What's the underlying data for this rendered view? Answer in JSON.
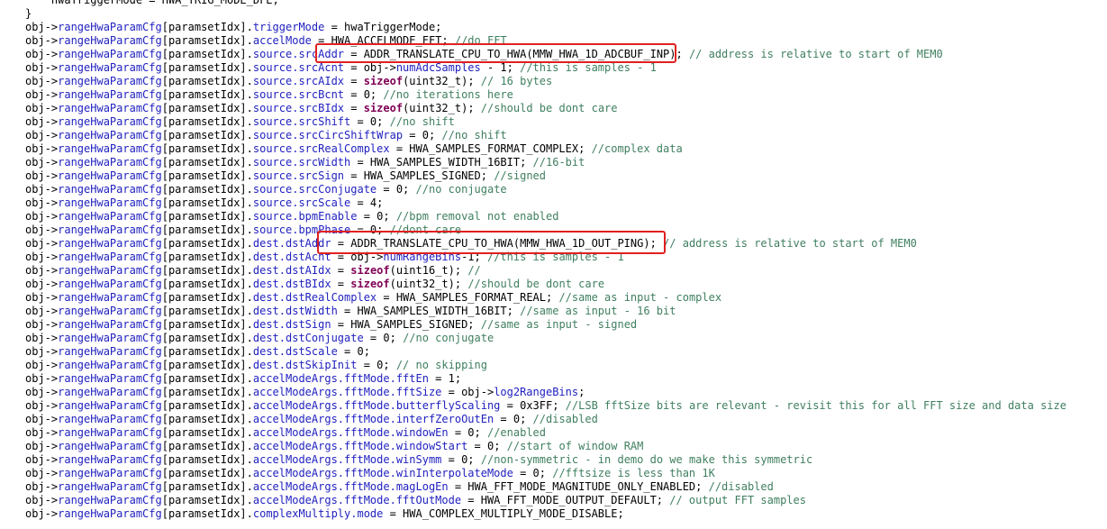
{
  "editor": {
    "lines": [
      [
        {
          "t": "    hwaTriggerMode = HWA_TRIG_MODE_DFE;",
          "c": "plain"
        }
      ],
      [
        {
          "t": "}",
          "c": "plain"
        }
      ],
      [
        {
          "t": "obj->",
          "c": "plain"
        },
        {
          "t": "rangeHwaParamCfg",
          "c": "blue"
        },
        {
          "t": "[paramsetIdx].",
          "c": "plain"
        },
        {
          "t": "triggerMode",
          "c": "blue"
        },
        {
          "t": " = hwaTriggerMode;",
          "c": "plain"
        }
      ],
      [
        {
          "t": "obj->",
          "c": "plain"
        },
        {
          "t": "rangeHwaParamCfg",
          "c": "blue"
        },
        {
          "t": "[paramsetIdx].",
          "c": "plain"
        },
        {
          "t": "accelMode",
          "c": "blue"
        },
        {
          "t": " = HWA_ACCELMODE_FFT; ",
          "c": "plain"
        },
        {
          "t": "//do FFT",
          "c": "cm"
        }
      ],
      [
        {
          "t": "obj->",
          "c": "plain"
        },
        {
          "t": "rangeHwaParamCfg",
          "c": "blue"
        },
        {
          "t": "[paramsetIdx].",
          "c": "plain"
        },
        {
          "t": "source.srcAddr",
          "c": "blue"
        },
        {
          "t": " = ADDR_TRANSLATE_CPU_TO_HWA(MMW_HWA_1D_ADCBUF_INP); ",
          "c": "plain"
        },
        {
          "t": "// address is relative to start of MEM0",
          "c": "cm"
        }
      ],
      [
        {
          "t": "obj->",
          "c": "plain"
        },
        {
          "t": "rangeHwaParamCfg",
          "c": "blue"
        },
        {
          "t": "[paramsetIdx].",
          "c": "plain"
        },
        {
          "t": "source.srcAcnt",
          "c": "blue"
        },
        {
          "t": " = obj->",
          "c": "plain"
        },
        {
          "t": "numAdcSamples",
          "c": "blue"
        },
        {
          "t": " - 1; ",
          "c": "plain"
        },
        {
          "t": "//this is samples - 1",
          "c": "cm"
        }
      ],
      [
        {
          "t": "obj->",
          "c": "plain"
        },
        {
          "t": "rangeHwaParamCfg",
          "c": "blue"
        },
        {
          "t": "[paramsetIdx].",
          "c": "plain"
        },
        {
          "t": "source.srcAIdx",
          "c": "blue"
        },
        {
          "t": " = ",
          "c": "plain"
        },
        {
          "t": "sizeof",
          "c": "kw"
        },
        {
          "t": "(uint32_t); ",
          "c": "plain"
        },
        {
          "t": "// 16 bytes",
          "c": "cm"
        }
      ],
      [
        {
          "t": "obj->",
          "c": "plain"
        },
        {
          "t": "rangeHwaParamCfg",
          "c": "blue"
        },
        {
          "t": "[paramsetIdx].",
          "c": "plain"
        },
        {
          "t": "source.srcBcnt",
          "c": "blue"
        },
        {
          "t": " = 0; ",
          "c": "plain"
        },
        {
          "t": "//no iterations here",
          "c": "cm"
        }
      ],
      [
        {
          "t": "obj->",
          "c": "plain"
        },
        {
          "t": "rangeHwaParamCfg",
          "c": "blue"
        },
        {
          "t": "[paramsetIdx].",
          "c": "plain"
        },
        {
          "t": "source.srcBIdx",
          "c": "blue"
        },
        {
          "t": " = ",
          "c": "plain"
        },
        {
          "t": "sizeof",
          "c": "kw"
        },
        {
          "t": "(uint32_t); ",
          "c": "plain"
        },
        {
          "t": "//should be dont care",
          "c": "cm"
        }
      ],
      [
        {
          "t": "obj->",
          "c": "plain"
        },
        {
          "t": "rangeHwaParamCfg",
          "c": "blue"
        },
        {
          "t": "[paramsetIdx].",
          "c": "plain"
        },
        {
          "t": "source.srcShift",
          "c": "blue"
        },
        {
          "t": " = 0; ",
          "c": "plain"
        },
        {
          "t": "//no shift",
          "c": "cm"
        }
      ],
      [
        {
          "t": "obj->",
          "c": "plain"
        },
        {
          "t": "rangeHwaParamCfg",
          "c": "blue"
        },
        {
          "t": "[paramsetIdx].",
          "c": "plain"
        },
        {
          "t": "source.srcCircShiftWrap",
          "c": "blue"
        },
        {
          "t": " = 0; ",
          "c": "plain"
        },
        {
          "t": "//no shift",
          "c": "cm"
        }
      ],
      [
        {
          "t": "obj->",
          "c": "plain"
        },
        {
          "t": "rangeHwaParamCfg",
          "c": "blue"
        },
        {
          "t": "[paramsetIdx].",
          "c": "plain"
        },
        {
          "t": "source.srcRealComplex",
          "c": "blue"
        },
        {
          "t": " = HWA_SAMPLES_FORMAT_COMPLEX; ",
          "c": "plain"
        },
        {
          "t": "//complex data",
          "c": "cm"
        }
      ],
      [
        {
          "t": "obj->",
          "c": "plain"
        },
        {
          "t": "rangeHwaParamCfg",
          "c": "blue"
        },
        {
          "t": "[paramsetIdx].",
          "c": "plain"
        },
        {
          "t": "source.srcWidth",
          "c": "blue"
        },
        {
          "t": " = HWA_SAMPLES_WIDTH_16BIT; ",
          "c": "plain"
        },
        {
          "t": "//16-bit",
          "c": "cm"
        }
      ],
      [
        {
          "t": "obj->",
          "c": "plain"
        },
        {
          "t": "rangeHwaParamCfg",
          "c": "blue"
        },
        {
          "t": "[paramsetIdx].",
          "c": "plain"
        },
        {
          "t": "source.srcSign",
          "c": "blue"
        },
        {
          "t": " = HWA_SAMPLES_SIGNED; ",
          "c": "plain"
        },
        {
          "t": "//signed",
          "c": "cm"
        }
      ],
      [
        {
          "t": "obj->",
          "c": "plain"
        },
        {
          "t": "rangeHwaParamCfg",
          "c": "blue"
        },
        {
          "t": "[paramsetIdx].",
          "c": "plain"
        },
        {
          "t": "source.srcConjugate",
          "c": "blue"
        },
        {
          "t": " = 0; ",
          "c": "plain"
        },
        {
          "t": "//no conjugate",
          "c": "cm"
        }
      ],
      [
        {
          "t": "obj->",
          "c": "plain"
        },
        {
          "t": "rangeHwaParamCfg",
          "c": "blue"
        },
        {
          "t": "[paramsetIdx].",
          "c": "plain"
        },
        {
          "t": "source.srcScale",
          "c": "blue"
        },
        {
          "t": " = 4;",
          "c": "plain"
        }
      ],
      [
        {
          "t": "obj->",
          "c": "plain"
        },
        {
          "t": "rangeHwaParamCfg",
          "c": "blue"
        },
        {
          "t": "[paramsetIdx].",
          "c": "plain"
        },
        {
          "t": "source.bpmEnable",
          "c": "blue"
        },
        {
          "t": " = 0; ",
          "c": "plain"
        },
        {
          "t": "//bpm removal not enabled",
          "c": "cm"
        }
      ],
      [
        {
          "t": "obj->",
          "c": "plain"
        },
        {
          "t": "rangeHwaParamCfg",
          "c": "blue"
        },
        {
          "t": "[paramsetIdx].",
          "c": "plain"
        },
        {
          "t": "source.bpmPhase",
          "c": "blue"
        },
        {
          "t": " = 0; ",
          "c": "plain"
        },
        {
          "t": "//dont care",
          "c": "cm"
        }
      ],
      [
        {
          "t": "obj->",
          "c": "plain"
        },
        {
          "t": "rangeHwaParamCfg",
          "c": "blue"
        },
        {
          "t": "[paramsetIdx].",
          "c": "plain"
        },
        {
          "t": "dest.dstAddr",
          "c": "blue"
        },
        {
          "t": " = ADDR_TRANSLATE_CPU_TO_HWA(MMW_HWA_1D_OUT_PING); ",
          "c": "plain"
        },
        {
          "t": "// address is relative to start of MEM0",
          "c": "cm"
        }
      ],
      [
        {
          "t": "obj->",
          "c": "plain"
        },
        {
          "t": "rangeHwaParamCfg",
          "c": "blue"
        },
        {
          "t": "[paramsetIdx].",
          "c": "plain"
        },
        {
          "t": "dest.dstAcnt",
          "c": "blue"
        },
        {
          "t": " = obj->",
          "c": "plain"
        },
        {
          "t": "numRangeBins",
          "c": "blue"
        },
        {
          "t": "-1; ",
          "c": "plain"
        },
        {
          "t": "//this is samples - 1",
          "c": "cm"
        }
      ],
      [
        {
          "t": "obj->",
          "c": "plain"
        },
        {
          "t": "rangeHwaParamCfg",
          "c": "blue"
        },
        {
          "t": "[paramsetIdx].",
          "c": "plain"
        },
        {
          "t": "dest.dstAIdx",
          "c": "blue"
        },
        {
          "t": " = ",
          "c": "plain"
        },
        {
          "t": "sizeof",
          "c": "kw"
        },
        {
          "t": "(uint16_t); ",
          "c": "plain"
        },
        {
          "t": "//",
          "c": "cm"
        }
      ],
      [
        {
          "t": "obj->",
          "c": "plain"
        },
        {
          "t": "rangeHwaParamCfg",
          "c": "blue"
        },
        {
          "t": "[paramsetIdx].",
          "c": "plain"
        },
        {
          "t": "dest.dstBIdx",
          "c": "blue"
        },
        {
          "t": " = ",
          "c": "plain"
        },
        {
          "t": "sizeof",
          "c": "kw"
        },
        {
          "t": "(uint32_t); ",
          "c": "plain"
        },
        {
          "t": "//should be dont care",
          "c": "cm"
        }
      ],
      [
        {
          "t": "obj->",
          "c": "plain"
        },
        {
          "t": "rangeHwaParamCfg",
          "c": "blue"
        },
        {
          "t": "[paramsetIdx].",
          "c": "plain"
        },
        {
          "t": "dest.dstRealComplex",
          "c": "blue"
        },
        {
          "t": " = HWA_SAMPLES_FORMAT_REAL; ",
          "c": "plain"
        },
        {
          "t": "//same as input - complex",
          "c": "cm"
        }
      ],
      [
        {
          "t": "obj->",
          "c": "plain"
        },
        {
          "t": "rangeHwaParamCfg",
          "c": "blue"
        },
        {
          "t": "[paramsetIdx].",
          "c": "plain"
        },
        {
          "t": "dest.dstWidth",
          "c": "blue"
        },
        {
          "t": " = HWA_SAMPLES_WIDTH_16BIT; ",
          "c": "plain"
        },
        {
          "t": "//same as input - 16 bit",
          "c": "cm"
        }
      ],
      [
        {
          "t": "obj->",
          "c": "plain"
        },
        {
          "t": "rangeHwaParamCfg",
          "c": "blue"
        },
        {
          "t": "[paramsetIdx].",
          "c": "plain"
        },
        {
          "t": "dest.dstSign",
          "c": "blue"
        },
        {
          "t": " = HWA_SAMPLES_SIGNED; ",
          "c": "plain"
        },
        {
          "t": "//same as input - signed",
          "c": "cm"
        }
      ],
      [
        {
          "t": "obj->",
          "c": "plain"
        },
        {
          "t": "rangeHwaParamCfg",
          "c": "blue"
        },
        {
          "t": "[paramsetIdx].",
          "c": "plain"
        },
        {
          "t": "dest.dstConjugate",
          "c": "blue"
        },
        {
          "t": " = 0; ",
          "c": "plain"
        },
        {
          "t": "//no conjugate",
          "c": "cm"
        }
      ],
      [
        {
          "t": "obj->",
          "c": "plain"
        },
        {
          "t": "rangeHwaParamCfg",
          "c": "blue"
        },
        {
          "t": "[paramsetIdx].",
          "c": "plain"
        },
        {
          "t": "dest.dstScale",
          "c": "blue"
        },
        {
          "t": " = 0;",
          "c": "plain"
        }
      ],
      [
        {
          "t": "obj->",
          "c": "plain"
        },
        {
          "t": "rangeHwaParamCfg",
          "c": "blue"
        },
        {
          "t": "[paramsetIdx].",
          "c": "plain"
        },
        {
          "t": "dest.dstSkipInit",
          "c": "blue"
        },
        {
          "t": " = 0; ",
          "c": "plain"
        },
        {
          "t": "// no skipping",
          "c": "cm"
        }
      ],
      [
        {
          "t": "obj->",
          "c": "plain"
        },
        {
          "t": "rangeHwaParamCfg",
          "c": "blue"
        },
        {
          "t": "[paramsetIdx].",
          "c": "plain"
        },
        {
          "t": "accelModeArgs.fftMode.fftEn",
          "c": "blue"
        },
        {
          "t": " = 1;",
          "c": "plain"
        }
      ],
      [
        {
          "t": "obj->",
          "c": "plain"
        },
        {
          "t": "rangeHwaParamCfg",
          "c": "blue"
        },
        {
          "t": "[paramsetIdx].",
          "c": "plain"
        },
        {
          "t": "accelModeArgs.fftMode.fftSize",
          "c": "blue"
        },
        {
          "t": " = obj->",
          "c": "plain"
        },
        {
          "t": "log2RangeBins",
          "c": "blue"
        },
        {
          "t": ";",
          "c": "plain"
        }
      ],
      [
        {
          "t": "obj->",
          "c": "plain"
        },
        {
          "t": "rangeHwaParamCfg",
          "c": "blue"
        },
        {
          "t": "[paramsetIdx].",
          "c": "plain"
        },
        {
          "t": "accelModeArgs.fftMode.butterflyScaling",
          "c": "blue"
        },
        {
          "t": " = 0x3FF; ",
          "c": "plain"
        },
        {
          "t": "//LSB fftSize bits are relevant - revisit this for all FFT size and data size",
          "c": "cm"
        }
      ],
      [
        {
          "t": "obj->",
          "c": "plain"
        },
        {
          "t": "rangeHwaParamCfg",
          "c": "blue"
        },
        {
          "t": "[paramsetIdx].",
          "c": "plain"
        },
        {
          "t": "accelModeArgs.fftMode.interfZeroOutEn",
          "c": "blue"
        },
        {
          "t": " = 0; ",
          "c": "plain"
        },
        {
          "t": "//disabled",
          "c": "cm"
        }
      ],
      [
        {
          "t": "obj->",
          "c": "plain"
        },
        {
          "t": "rangeHwaParamCfg",
          "c": "blue"
        },
        {
          "t": "[paramsetIdx].",
          "c": "plain"
        },
        {
          "t": "accelModeArgs.fftMode.windowEn",
          "c": "blue"
        },
        {
          "t": " = 0; ",
          "c": "plain"
        },
        {
          "t": "//enabled",
          "c": "cm"
        }
      ],
      [
        {
          "t": "obj->",
          "c": "plain"
        },
        {
          "t": "rangeHwaParamCfg",
          "c": "blue"
        },
        {
          "t": "[paramsetIdx].",
          "c": "plain"
        },
        {
          "t": "accelModeArgs.fftMode.windowStart",
          "c": "blue"
        },
        {
          "t": " = 0; ",
          "c": "plain"
        },
        {
          "t": "//start of window RAM",
          "c": "cm"
        }
      ],
      [
        {
          "t": "obj->",
          "c": "plain"
        },
        {
          "t": "rangeHwaParamCfg",
          "c": "blue"
        },
        {
          "t": "[paramsetIdx].",
          "c": "plain"
        },
        {
          "t": "accelModeArgs.fftMode.winSymm",
          "c": "blue"
        },
        {
          "t": " = 0; ",
          "c": "plain"
        },
        {
          "t": "//non-symmetric - in demo do we make this symmetric",
          "c": "cm"
        }
      ],
      [
        {
          "t": "obj->",
          "c": "plain"
        },
        {
          "t": "rangeHwaParamCfg",
          "c": "blue"
        },
        {
          "t": "[paramsetIdx].",
          "c": "plain"
        },
        {
          "t": "accelModeArgs.fftMode.winInterpolateMode",
          "c": "blue"
        },
        {
          "t": " = 0; ",
          "c": "plain"
        },
        {
          "t": "//fftsize is less than 1K",
          "c": "cm"
        }
      ],
      [
        {
          "t": "obj->",
          "c": "plain"
        },
        {
          "t": "rangeHwaParamCfg",
          "c": "blue"
        },
        {
          "t": "[paramsetIdx].",
          "c": "plain"
        },
        {
          "t": "accelModeArgs.fftMode.magLogEn",
          "c": "blue"
        },
        {
          "t": " = HWA_FFT_MODE_MAGNITUDE_ONLY_ENABLED; ",
          "c": "plain"
        },
        {
          "t": "//disabled",
          "c": "cm"
        }
      ],
      [
        {
          "t": "obj->",
          "c": "plain"
        },
        {
          "t": "rangeHwaParamCfg",
          "c": "blue"
        },
        {
          "t": "[paramsetIdx].",
          "c": "plain"
        },
        {
          "t": "accelModeArgs.fftMode.fftOutMode",
          "c": "blue"
        },
        {
          "t": " = HWA_FFT_MODE_OUTPUT_DEFAULT; ",
          "c": "plain"
        },
        {
          "t": "// output FFT samples",
          "c": "cm"
        }
      ],
      [
        {
          "t": "obj->",
          "c": "plain"
        },
        {
          "t": "rangeHwaParamCfg",
          "c": "blue"
        },
        {
          "t": "[paramsetIdx].",
          "c": "plain"
        },
        {
          "t": "complexMultiply.mode",
          "c": "blue"
        },
        {
          "t": " = HWA_COMPLEX_MULTIPLY_MODE_DISABLE;",
          "c": "plain"
        }
      ]
    ]
  },
  "colors": {
    "member": "#1f1fbf",
    "keyword": "#7f0055",
    "comment": "#3f7f5f",
    "highlight_box": "#e02020",
    "background": "#ffffff"
  }
}
